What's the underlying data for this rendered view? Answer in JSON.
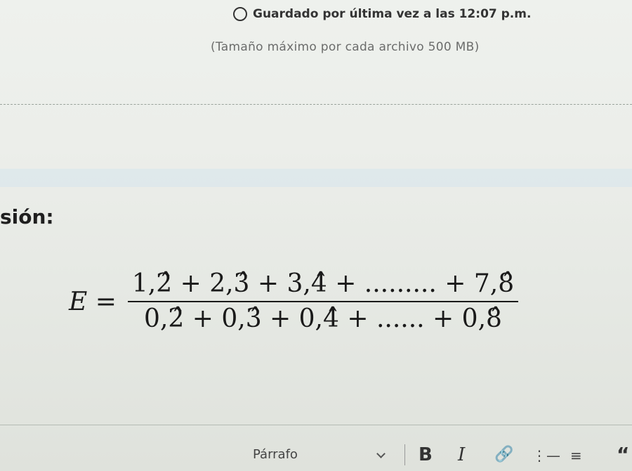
{
  "status": {
    "saved_text": "Guardado por última vez a las 12:07 p.m.",
    "icon": "clock-icon"
  },
  "upload": {
    "size_note": "(Tamaño máximo por cada archivo 500 MB)"
  },
  "section": {
    "label": "sión:"
  },
  "equation": {
    "lhs": "E =",
    "numerator": "1,2̂ + 2,3̂ + 3,4̂ + ......... + 7,8̂",
    "denominator": "0,2̂ + 0,3̂ + 0,4̂ + ...... + 0,8̂"
  },
  "toolbar": {
    "paragraph_label": "Párrafo",
    "bold_label": "B",
    "italic_label": "I",
    "link_icon": "link-icon",
    "bullet_list_icon": "bullet-list-icon",
    "numbered_list_icon": "numbered-list-icon",
    "quote_icon": "quote-icon"
  }
}
